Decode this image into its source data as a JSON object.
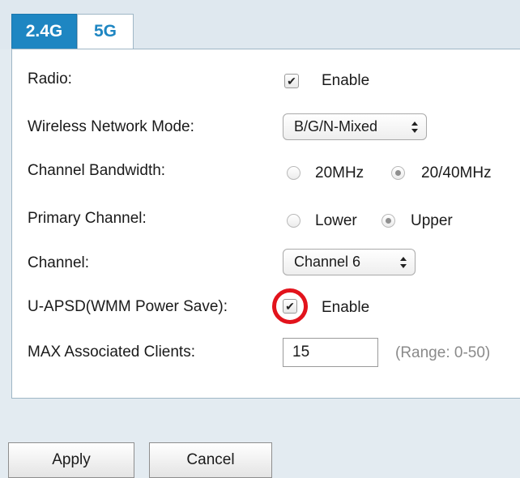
{
  "tabs": [
    {
      "label": "2.4G",
      "active": true
    },
    {
      "label": "5G",
      "active": false
    }
  ],
  "form": {
    "radio": {
      "label": "Radio:",
      "checked": true,
      "option_label": "Enable"
    },
    "network_mode": {
      "label": "Wireless Network Mode:",
      "value": "B/G/N-Mixed"
    },
    "bandwidth": {
      "label": "Channel Bandwidth:",
      "options": [
        "20MHz",
        "20/40MHz"
      ],
      "selected": "20/40MHz"
    },
    "primary_channel": {
      "label": "Primary Channel:",
      "options": [
        "Lower",
        "Upper"
      ],
      "selected": "Upper"
    },
    "channel": {
      "label": "Channel:",
      "value": "Channel 6"
    },
    "uapsd": {
      "label": "U-APSD(WMM Power Save):",
      "checked": true,
      "option_label": "Enable"
    },
    "max_clients": {
      "label": "MAX Associated Clients:",
      "value": "15",
      "hint": "(Range: 0-50)"
    }
  },
  "buttons": {
    "apply": "Apply",
    "cancel": "Cancel"
  },
  "colors": {
    "tab_active": "#1e86c2",
    "highlight": "#e2131c",
    "background": "#e3ebf1"
  }
}
